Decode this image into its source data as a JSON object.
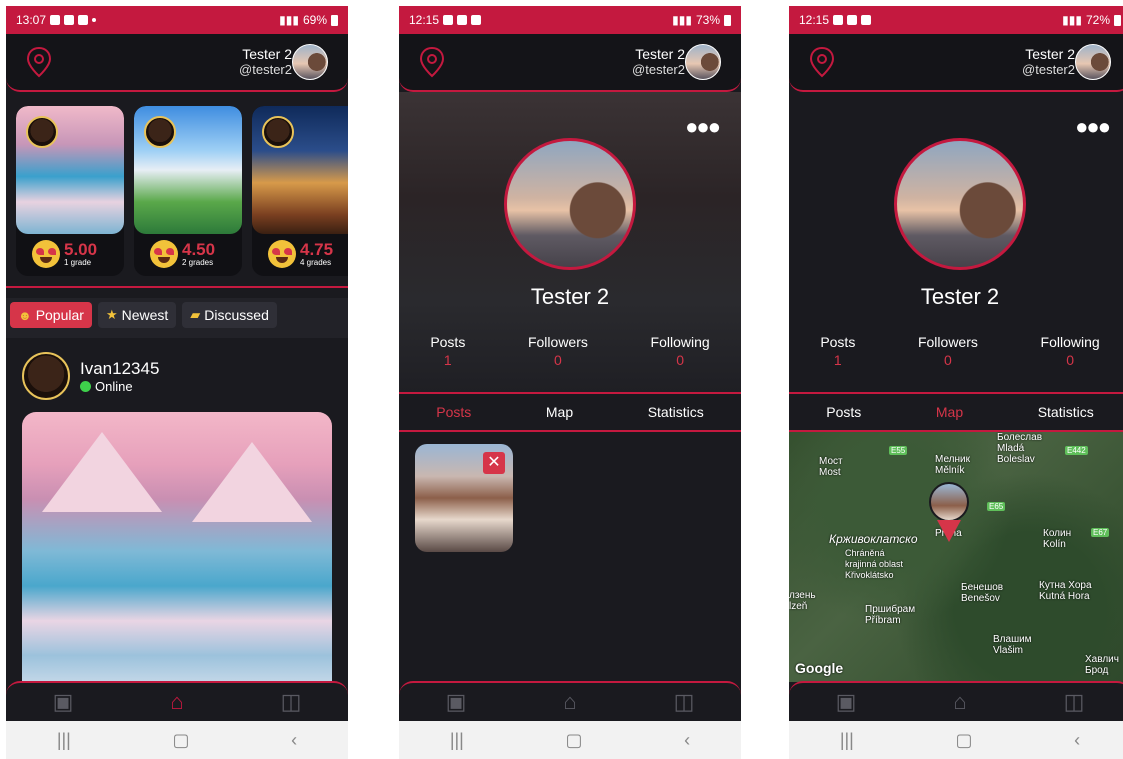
{
  "phone1": {
    "status": {
      "time": "13:07",
      "battery": "69%"
    },
    "header": {
      "name": "Tester 2",
      "handle": "@tester2"
    },
    "stories": [
      {
        "rating": "5.00",
        "grades": "1 grade"
      },
      {
        "rating": "4.50",
        "grades": "2 grades"
      },
      {
        "rating": "4.75",
        "grades": "4 grades"
      }
    ],
    "filters": {
      "popular": "Popular",
      "newest": "Newest",
      "discussed": "Discussed"
    },
    "post": {
      "user": "Ivan12345",
      "status": "Online"
    }
  },
  "phone2": {
    "status": {
      "time": "12:15",
      "battery": "73%"
    },
    "header": {
      "name": "Tester 2",
      "handle": "@tester2"
    },
    "profile": {
      "name": "Tester 2"
    },
    "stats": {
      "posts_label": "Posts",
      "posts": "1",
      "followers_label": "Followers",
      "followers": "0",
      "following_label": "Following",
      "following": "0"
    },
    "tabs": {
      "posts": "Posts",
      "map": "Map",
      "statistics": "Statistics"
    }
  },
  "phone3": {
    "status": {
      "time": "12:15",
      "battery": "72%"
    },
    "header": {
      "name": "Tester 2",
      "handle": "@tester2"
    },
    "profile": {
      "name": "Tester 2"
    },
    "stats": {
      "posts_label": "Posts",
      "posts": "1",
      "followers_label": "Followers",
      "followers": "0",
      "following_label": "Following",
      "following": "0"
    },
    "tabs": {
      "posts": "Posts",
      "map": "Map",
      "statistics": "Statistics"
    },
    "map": {
      "labels": {
        "most": "Мост\nMost",
        "melnik": "Мелник\nMělník",
        "boleslav": "Болеслав\nMladá\nBoleslav",
        "krivoklatsko": "Крживоклатско",
        "chranena": "Chráněná\nkrajinná oblast\nKřivoklátsko",
        "kolin": "Колин\nKolín",
        "benesov": "Бенешов\nBenešov",
        "kutna": "Кутна Хора\nKutná Hora",
        "pribram": "Пршибрам\nPříbram",
        "vlasim": "Влашим\nVlašim",
        "plzen": "лзень\nlzeň",
        "havlic": "Хавлич\nБрод",
        "praha": "Praha"
      },
      "roads": {
        "e55": "E55",
        "e442": "E442",
        "e65": "E65",
        "e67": "E67"
      },
      "attribution": "Google"
    }
  }
}
